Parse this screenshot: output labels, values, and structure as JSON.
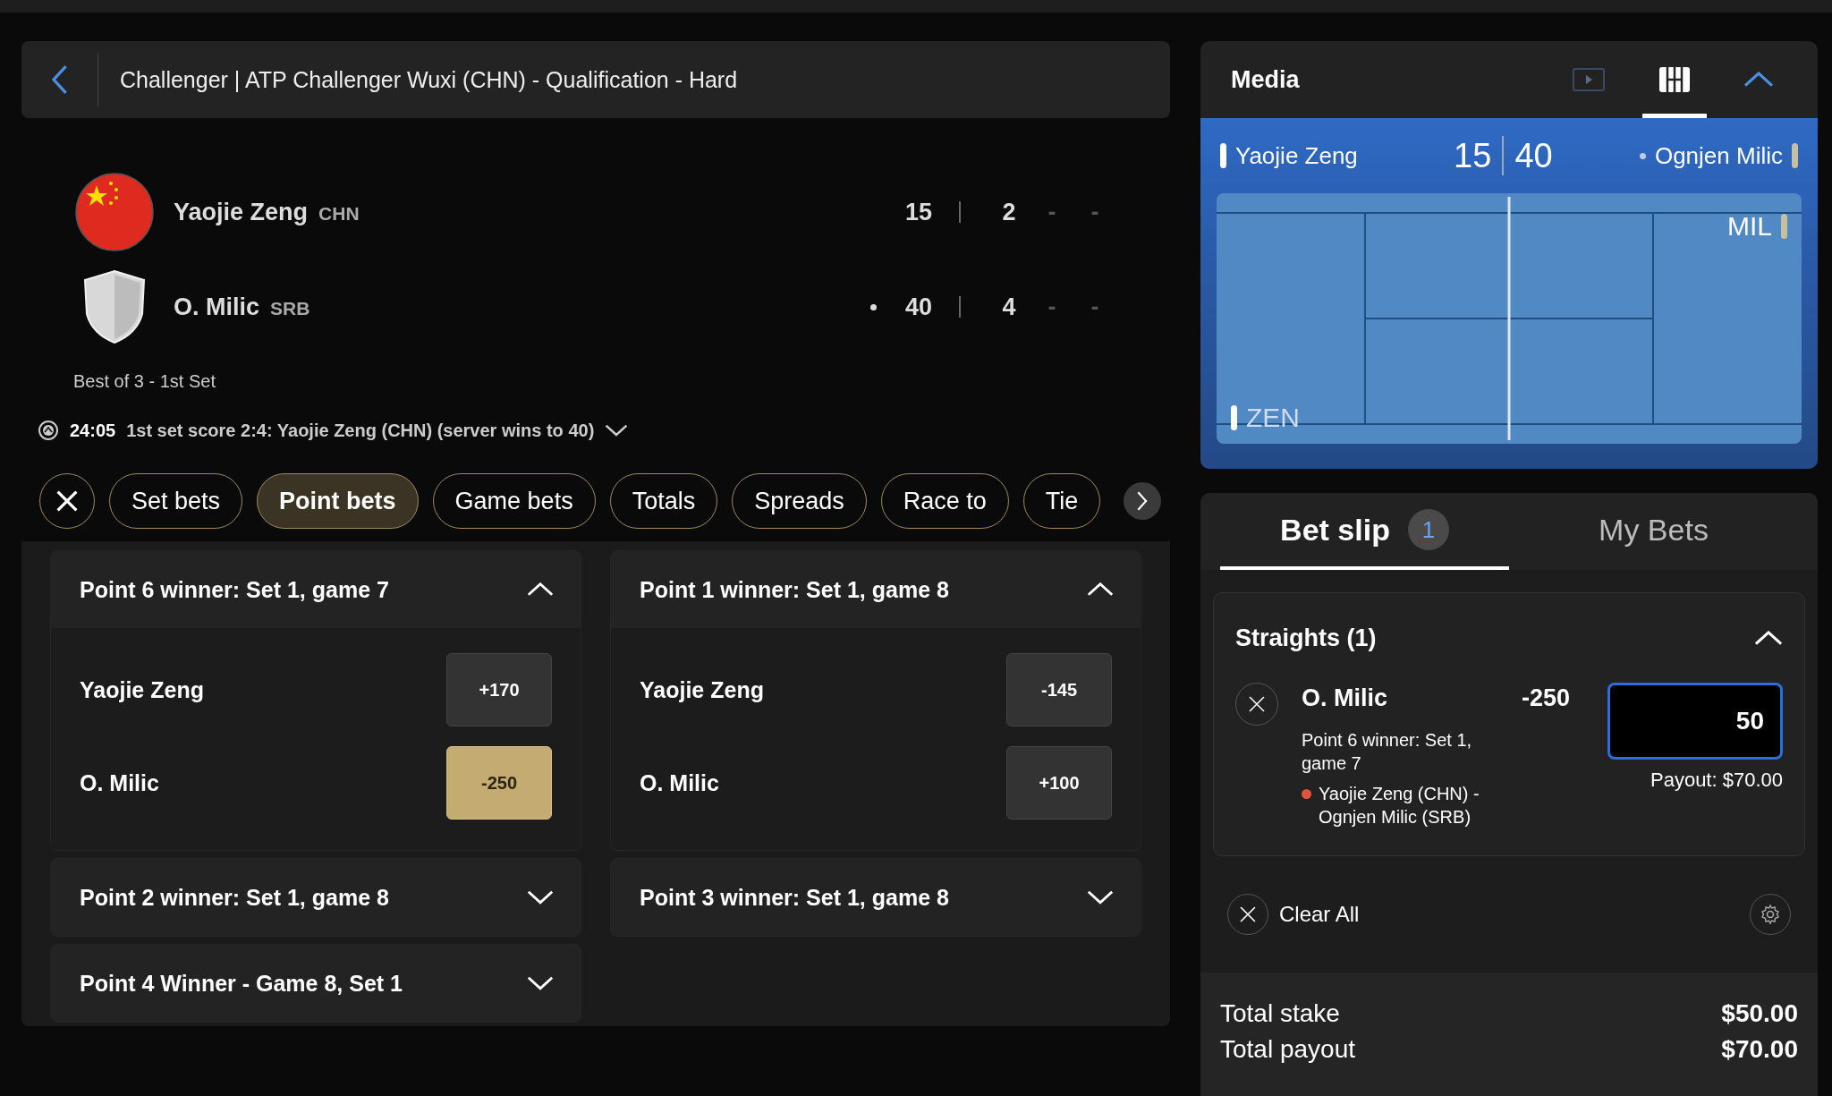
{
  "header": {
    "title": "Challenger | ATP Challenger Wuxi (CHN) - Qualification - Hard"
  },
  "players": [
    {
      "name": "Yaojie Zeng",
      "country": "CHN",
      "flag": {
        "kind": "china"
      },
      "serving": false,
      "points": "15",
      "sets": [
        "2",
        "-",
        "-"
      ]
    },
    {
      "name": "O. Milic",
      "country": "SRB",
      "flag": {
        "kind": "shield"
      },
      "serving": true,
      "points": "40",
      "sets": [
        "4",
        "-",
        "-"
      ]
    }
  ],
  "match_format": "Best of 3 - 1st Set",
  "status": {
    "time": "24:05",
    "text": "1st set score 2:4: Yaojie Zeng (CHN) (server wins to 40)",
    "expanded": false
  },
  "chips": [
    {
      "label": "Set bets",
      "selected": false
    },
    {
      "label": "Point bets",
      "selected": true
    },
    {
      "label": "Game bets",
      "selected": false
    },
    {
      "label": "Totals",
      "selected": false
    },
    {
      "label": "Spreads",
      "selected": false
    },
    {
      "label": "Race to",
      "selected": false
    },
    {
      "label": "Tie",
      "selected": false
    }
  ],
  "market_columns": [
    {
      "markets": [
        {
          "title": "Point 6 winner: Set 1, game 7",
          "expanded": true,
          "outcomes": [
            {
              "name": "Yaojie Zeng",
              "odds": "+170",
              "selected": false
            },
            {
              "name": "O. Milic",
              "odds": "-250",
              "selected": true
            }
          ]
        },
        {
          "title": "Point 2 winner: Set 1, game 8",
          "expanded": false
        },
        {
          "title": "Point 4 Winner - Game 8, Set 1",
          "expanded": false
        }
      ]
    },
    {
      "markets": [
        {
          "title": "Point 1 winner: Set 1, game 8",
          "expanded": true,
          "outcomes": [
            {
              "name": "Yaojie Zeng",
              "odds": "-145",
              "selected": false
            },
            {
              "name": "O. Milic",
              "odds": "+100",
              "selected": false
            }
          ]
        },
        {
          "title": "Point 3 winner: Set 1, game 8",
          "expanded": false
        }
      ]
    }
  ],
  "media": {
    "title": "Media",
    "views": [
      {
        "kind": "video",
        "selected": false
      },
      {
        "kind": "court",
        "selected": true
      }
    ],
    "expanded": true,
    "scoreboard": {
      "home": {
        "name": "Yaojie Zeng",
        "points": "15",
        "serving": false,
        "color": "#ffffff"
      },
      "away": {
        "name": "Ognjen Milic",
        "points": "40",
        "serving": true,
        "color": "#c8bfa0"
      }
    },
    "court_labels": {
      "away": "MIL",
      "home": "ZEN"
    }
  },
  "bet_slip": {
    "tabs": [
      {
        "label": "Bet slip",
        "badge": "1",
        "selected": true
      },
      {
        "label": "My Bets",
        "selected": false
      }
    ],
    "group": {
      "title": "Straights (1)",
      "expanded": true,
      "bets": [
        {
          "selection": "O. Milic",
          "odds": "-250",
          "stake": "50",
          "market": "Point 6 winner: Set 1, game 7",
          "event": "Yaojie Zeng (CHN) - Ognjen Milic (SRB)",
          "color": "#e0533d",
          "payout": "Payout: $70.00"
        }
      ]
    },
    "clear_all": "Clear All",
    "totals": [
      {
        "label": "Total stake",
        "value": "$50.00"
      },
      {
        "label": "Total payout",
        "value": "$70.00"
      }
    ]
  }
}
